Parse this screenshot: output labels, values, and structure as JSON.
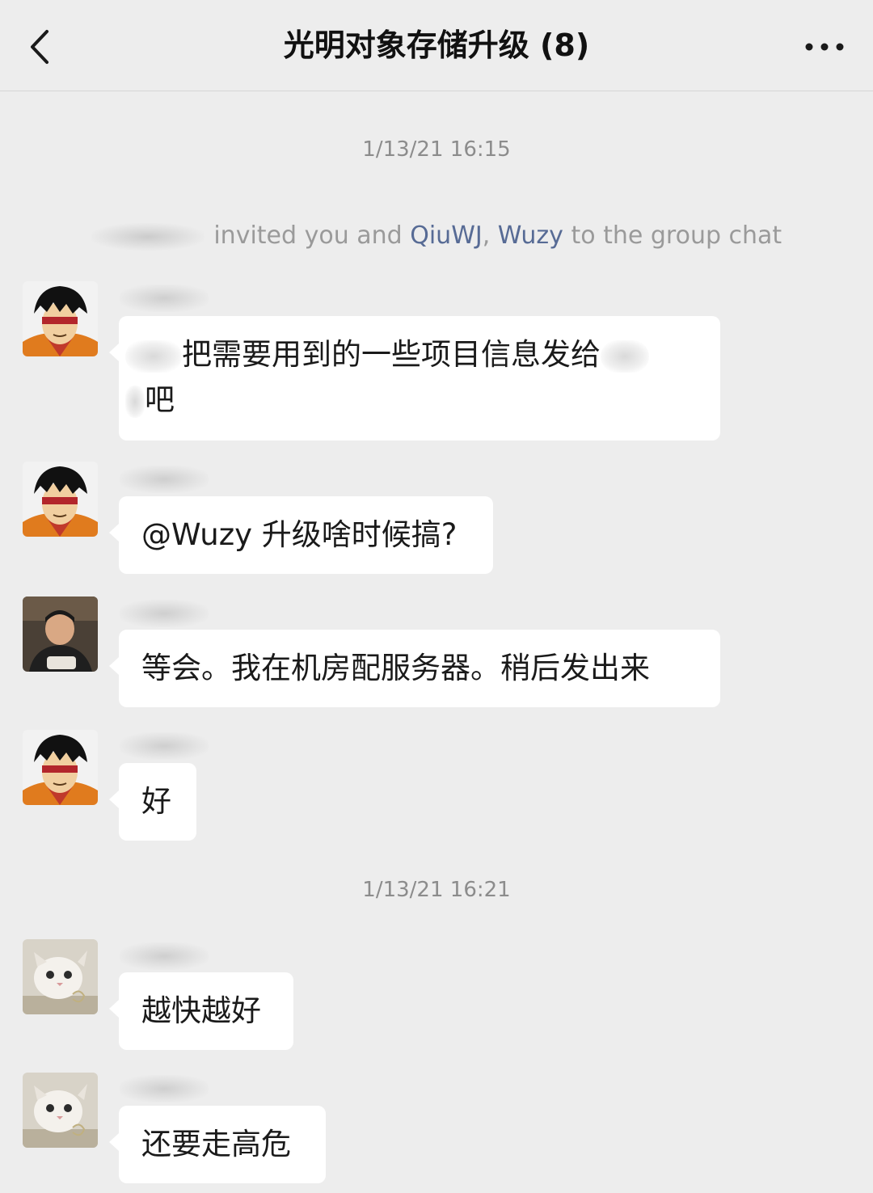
{
  "header": {
    "title": "光明对象存储升级 (8)",
    "back_icon": "chevron-left-icon",
    "more_icon": "more-dots-icon"
  },
  "chat": {
    "timestamps": [
      "1/13/21 16:15",
      "1/13/21 16:21"
    ],
    "system_message": {
      "text_invited": " invited you and ",
      "mention_1": "QiuWJ",
      "separator": ", ",
      "mention_2": "Wuzy",
      "text_end": " to the group chat"
    },
    "messages": [
      {
        "avatar": "cartoon-avatar",
        "text_line1": "把需要用到的一些项目信息发给",
        "text_line2": "吧"
      },
      {
        "avatar": "cartoon-avatar",
        "text": "@Wuzy  升级啥时候搞?"
      },
      {
        "avatar": "photo-avatar",
        "text": "等会。我在机房配服务器。稍后发出来"
      },
      {
        "avatar": "cartoon-avatar",
        "text": "好"
      },
      {
        "avatar": "cat-avatar",
        "text": "越快越好"
      },
      {
        "avatar": "cat-avatar",
        "text": "还要走高危"
      }
    ]
  },
  "colors": {
    "background": "#ededed",
    "bubble": "#ffffff",
    "mention": "#576b95",
    "timestamp": "#8c8c8c"
  }
}
